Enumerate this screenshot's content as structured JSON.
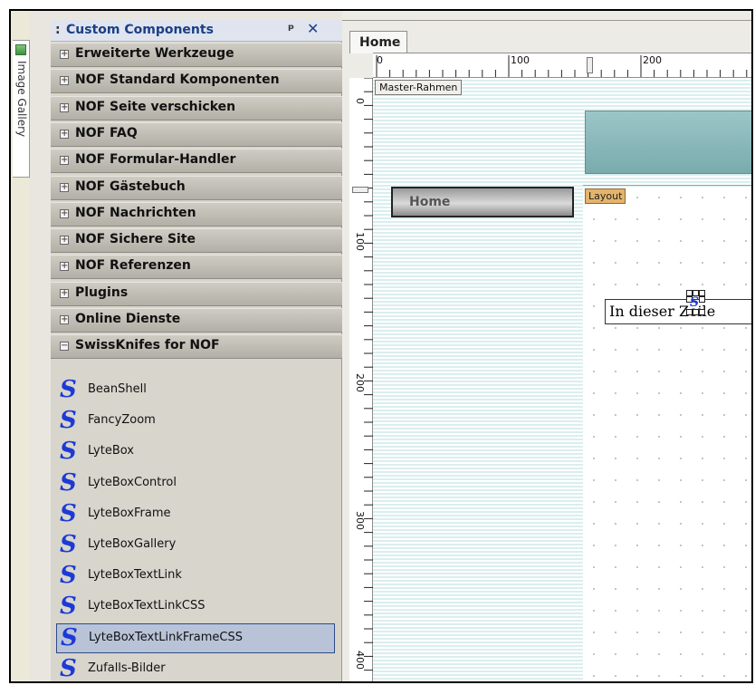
{
  "gallery_tab": {
    "label": "Image Gallery"
  },
  "panel": {
    "title": "Custom Components",
    "pin_glyph": "2 ",
    "pin_icon": "pin-icon",
    "close_glyph": "✕",
    "close_icon": "close-icon",
    "categories": [
      {
        "label": "Erweiterte Werkzeuge",
        "expander": "+"
      },
      {
        "label": "NOF Standard Komponenten",
        "expander": "+"
      },
      {
        "label": "NOF Seite verschicken",
        "expander": "+"
      },
      {
        "label": "NOF FAQ",
        "expander": "+"
      },
      {
        "label": "NOF Formular-Handler",
        "expander": "+"
      },
      {
        "label": "NOF Gästebuch",
        "expander": "+"
      },
      {
        "label": "NOF Nachrichten",
        "expander": "+"
      },
      {
        "label": "NOF Sichere Site",
        "expander": "+"
      },
      {
        "label": "NOF Referenzen",
        "expander": "+"
      },
      {
        "label": "Plugins",
        "expander": "+"
      },
      {
        "label": "Online Dienste",
        "expander": "+"
      },
      {
        "label": "SwissKnifes for NOF",
        "expander": "−"
      }
    ],
    "items": [
      {
        "label": "BeanShell",
        "icon": "S",
        "selected": false
      },
      {
        "label": "FancyZoom",
        "icon": "S",
        "selected": false
      },
      {
        "label": "LyteBox",
        "icon": "S",
        "selected": false
      },
      {
        "label": "LyteBoxControl",
        "icon": "S",
        "selected": false
      },
      {
        "label": "LyteBoxFrame",
        "icon": "S",
        "selected": false
      },
      {
        "label": "LyteBoxGallery",
        "icon": "S",
        "selected": false
      },
      {
        "label": "LyteBoxTextLink",
        "icon": "S",
        "selected": false
      },
      {
        "label": "LyteBoxTextLinkCSS",
        "icon": "S",
        "selected": false
      },
      {
        "label": "LyteBoxTextLinkFrameCSS",
        "icon": "S",
        "selected": true
      },
      {
        "label": "Zufalls-Bilder",
        "icon": "S",
        "selected": false
      }
    ]
  },
  "design": {
    "tab_label": "Home",
    "ruler_h_labels": [
      "0",
      "100",
      "200"
    ],
    "ruler_v_labels": [
      "0",
      "100",
      "200",
      "300",
      "400"
    ],
    "master_label": "Master-Rahmen",
    "home_button_label": "Home",
    "layout_label": "Layout",
    "text_box": "In dieser Zeile",
    "component_icon": "S"
  },
  "colors": {
    "panel_title": "#1c3f86",
    "s_icon": "#1d3ad6",
    "layout_tag": "#e4b46c",
    "banner": "#8fbbbd",
    "selection": "#b9c3d8"
  }
}
